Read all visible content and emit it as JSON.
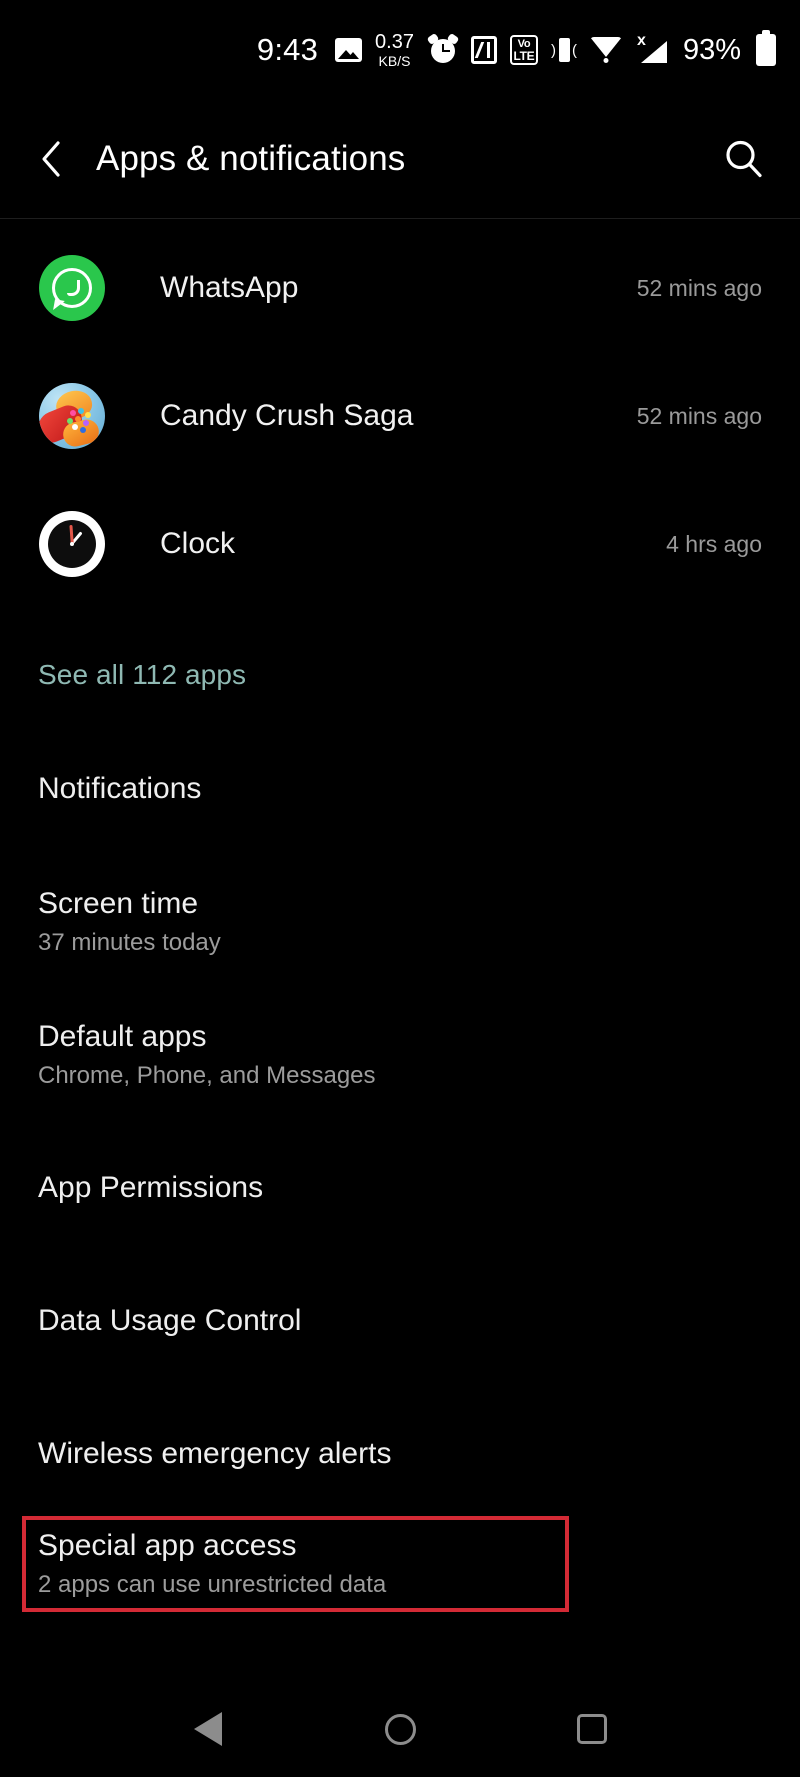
{
  "status_bar": {
    "time": "9:43",
    "net_speed_value": "0.37",
    "net_speed_unit": "KB/S",
    "volte_line1": "Vo",
    "volte_line2": "LTE",
    "signal_x": "x",
    "battery_percent": "93%",
    "icons": [
      "photo-icon",
      "net-speed-icon",
      "alarm-icon",
      "nfc-icon",
      "volte-icon",
      "vibrate-icon",
      "wifi-icon",
      "signal-no-sim-icon",
      "battery-icon"
    ]
  },
  "app_bar": {
    "back_label": "back-chevron",
    "title": "Apps & notifications",
    "search_label": "search-icon"
  },
  "recent_apps": [
    {
      "name": "WhatsApp",
      "time": "52 mins ago",
      "icon": "whatsapp-icon"
    },
    {
      "name": "Candy Crush Saga",
      "time": "52 mins ago",
      "icon": "candy-crush-icon"
    },
    {
      "name": "Clock",
      "time": "4 hrs ago",
      "icon": "clock-icon"
    }
  ],
  "see_all": {
    "label": "See all 112 apps",
    "color": "#8fb9b3"
  },
  "settings": [
    {
      "title": "Notifications",
      "subtitle": ""
    },
    {
      "title": "Screen time",
      "subtitle": "37 minutes today"
    },
    {
      "title": "Default apps",
      "subtitle": "Chrome, Phone, and Messages"
    },
    {
      "title": "App Permissions",
      "subtitle": ""
    },
    {
      "title": "Data Usage Control",
      "subtitle": ""
    },
    {
      "title": "Wireless emergency alerts",
      "subtitle": ""
    },
    {
      "title": "Special app access",
      "subtitle": "2 apps can use unrestricted data"
    }
  ],
  "highlight": {
    "target": "Special app access",
    "color": "#d32a35"
  },
  "nav_bar": {
    "back": "back-triangle-icon",
    "home": "home-circle-icon",
    "recents": "recents-square-icon"
  }
}
